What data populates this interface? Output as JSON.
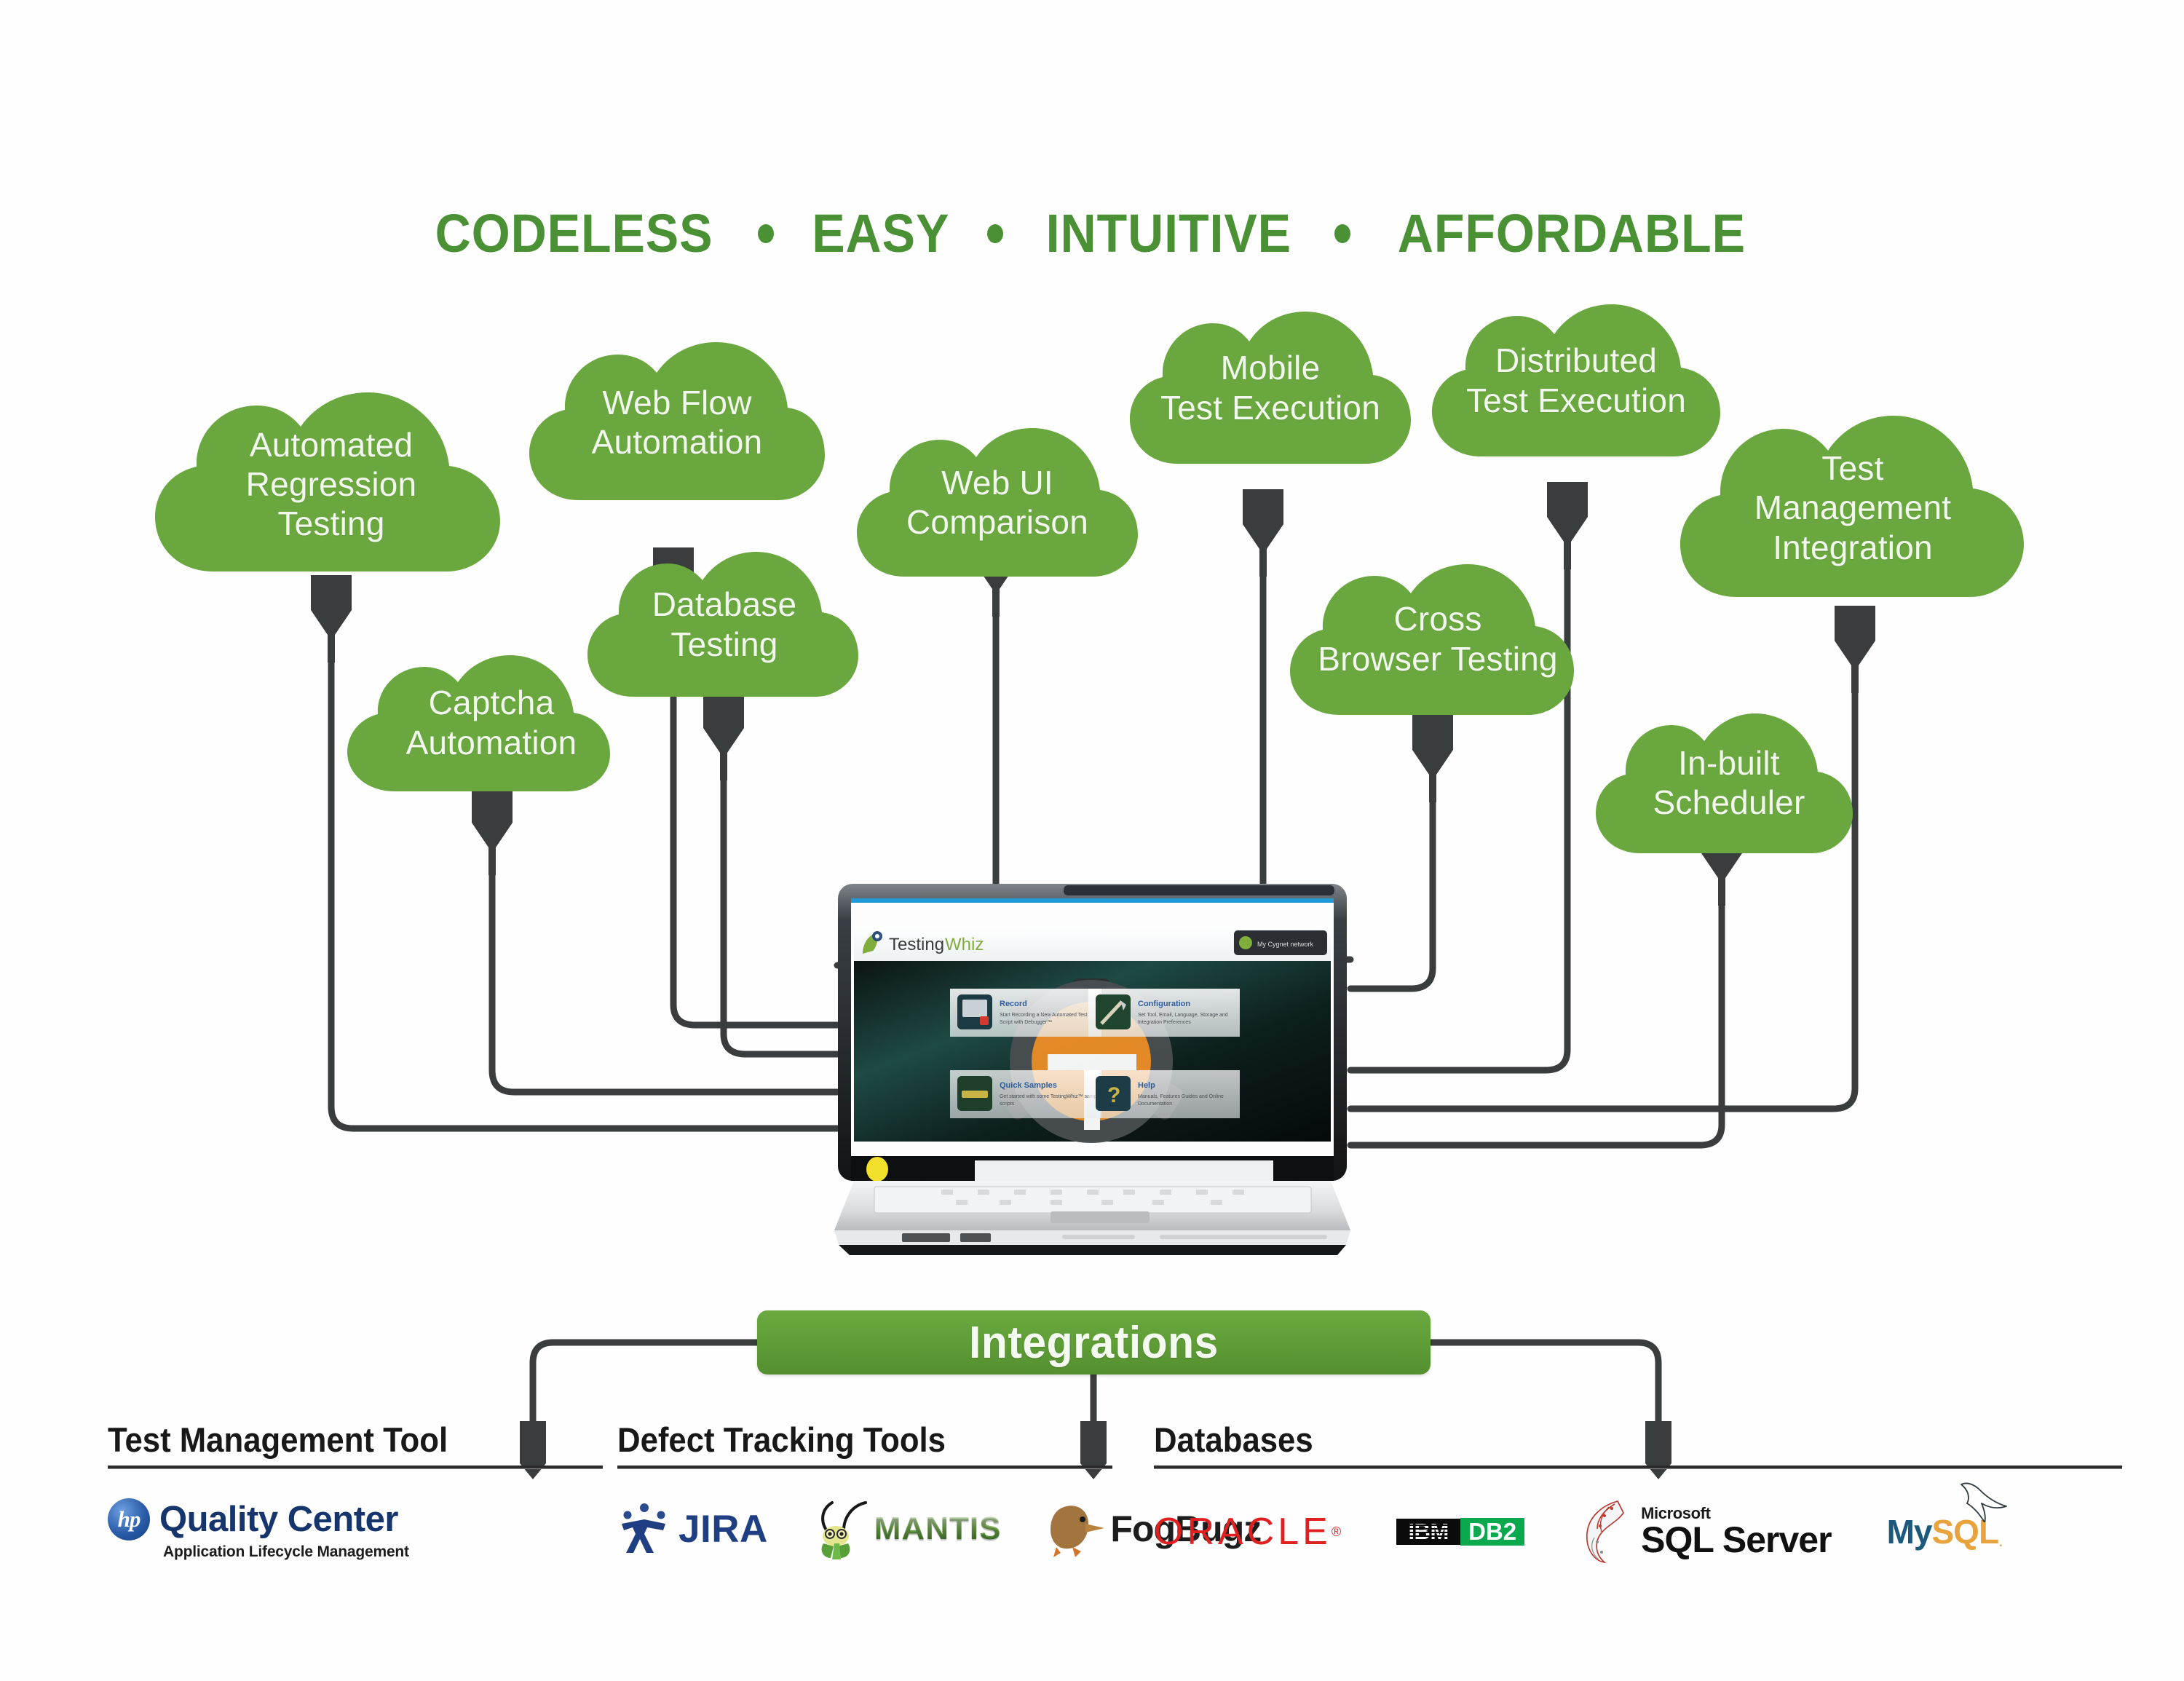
{
  "header": {
    "words": [
      "CODELESS",
      "EASY",
      "INTUITIVE",
      "AFFORDABLE"
    ],
    "separator": "•",
    "color": "#4a9034"
  },
  "theme": {
    "cloud_green": "#6aa83f",
    "cloud_text": "#f2f7ee",
    "wire_color": "#3a3d3d",
    "bar_green": "#5e9c36",
    "background": "#ffffff"
  },
  "features": [
    {
      "id": "automated-regression-testing",
      "label": "Automated\nRegression\nTesting",
      "lines": [
        "Automated",
        "Regression",
        "Testing"
      ]
    },
    {
      "id": "web-flow-automation",
      "label": "Web Flow\nAutomation",
      "lines": [
        "Web Flow",
        "Automation"
      ]
    },
    {
      "id": "web-ui-comparison",
      "label": "Web UI\nComparison",
      "lines": [
        "Web UI",
        "Comparison"
      ]
    },
    {
      "id": "mobile-test-execution",
      "label": "Mobile\nTest Execution",
      "lines": [
        "Mobile",
        "Test Execution"
      ]
    },
    {
      "id": "distributed-test-execution",
      "label": "Distributed\nTest Execution",
      "lines": [
        "Distributed",
        "Test Execution"
      ]
    },
    {
      "id": "test-management-integration",
      "label": "Test\nManagement\nIntegration",
      "lines": [
        "Test",
        "Management",
        "Integration"
      ]
    },
    {
      "id": "database-testing",
      "label": "Database\nTesting",
      "lines": [
        "Database",
        "Testing"
      ]
    },
    {
      "id": "captcha-automation",
      "label": "Captcha\nAutomation",
      "lines": [
        "Captcha",
        "Automation"
      ]
    },
    {
      "id": "cross-browser-testing",
      "label": "Cross\nBrowser Testing",
      "lines": [
        "Cross",
        "Browser Testing"
      ]
    },
    {
      "id": "in-built-scheduler",
      "label": "In-built\nScheduler",
      "lines": [
        "In-built",
        "Scheduler"
      ]
    }
  ],
  "cloud_text": {
    "automated_regression_testing": "Automated Regression Testing",
    "web_flow_automation": "Web Flow Automation",
    "web_ui_comparison": "Web UI Comparison",
    "mobile_test_execution": "Mobile Test Execution",
    "distributed_test_execution": "Distributed Test Execution",
    "test_management_integration": "Test Management Integration",
    "database_testing": "Database Testing",
    "captcha_automation": "Captcha Automation",
    "cross_browser_testing": "Cross Browser Testing",
    "in_built_scheduler": "In-built Scheduler"
  },
  "laptop": {
    "app_name_1": "Testing",
    "app_name_2": "Whiz",
    "account_badge": "My Cygnet network",
    "tiles": [
      {
        "title": "Record",
        "desc": "Start Recording a New Automated Test Script with Debugger™"
      },
      {
        "title": "Configuration",
        "desc": "Set Tool, Email, Language, Storage and Integration Preferences"
      },
      {
        "title": "Quick Samples",
        "desc": "Get started with some TestingWhiz™ sample scripts"
      },
      {
        "title": "Help",
        "desc": "Manuals, Features Guides and Online Documentation"
      }
    ]
  },
  "integrations": {
    "bar_label": "Integrations",
    "groups": [
      {
        "id": "test-management-tool",
        "title": "Test Management Tool",
        "logos": [
          {
            "id": "hp-quality-center",
            "name": "Quality Center",
            "badge": "hp",
            "sub": "Application Lifecycle Management"
          }
        ]
      },
      {
        "id": "defect-tracking-tools",
        "title": "Defect Tracking Tools",
        "logos": [
          {
            "id": "jira",
            "name": "JIRA"
          },
          {
            "id": "mantis",
            "name": "MANTIS"
          },
          {
            "id": "fogbugz",
            "name": "FogBugz"
          }
        ]
      },
      {
        "id": "databases",
        "title": "Databases",
        "logos": [
          {
            "id": "oracle",
            "name": "ORACLE",
            "mark": "®"
          },
          {
            "id": "ibm-db2",
            "name": "DB2",
            "vendor": "IBM"
          },
          {
            "id": "microsoft-sql-server",
            "name": "SQL Server",
            "vendor": "Microsoft"
          },
          {
            "id": "mysql",
            "name": "MySQL",
            "part1": "My",
            "part2": "SQL",
            "mark": "."
          }
        ]
      }
    ]
  }
}
